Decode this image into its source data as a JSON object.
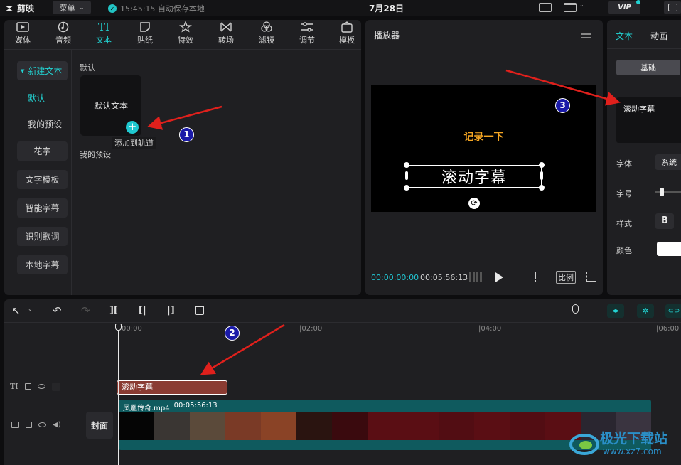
{
  "app": {
    "logo": "剪映",
    "menu_label": "菜单",
    "autosave": "15:45:15 自动保存本地",
    "project_title": "7月28日",
    "vip": "VIP"
  },
  "toolbar": {
    "tabs": [
      {
        "label": "媒体",
        "icon": "media-icon"
      },
      {
        "label": "音频",
        "icon": "audio-icon"
      },
      {
        "label": "文本",
        "icon": "text-icon",
        "active": true
      },
      {
        "label": "贴纸",
        "icon": "sticker-icon"
      },
      {
        "label": "特效",
        "icon": "effects-icon"
      },
      {
        "label": "转场",
        "icon": "transition-icon"
      },
      {
        "label": "滤镜",
        "icon": "filter-icon"
      },
      {
        "label": "调节",
        "icon": "adjust-icon"
      },
      {
        "label": "模板",
        "icon": "template-icon"
      }
    ]
  },
  "sidebar": {
    "items": [
      "新建文本",
      "默认",
      "我的预设",
      "花字",
      "文字模板",
      "智能字幕",
      "识别歌词",
      "本地字幕"
    ]
  },
  "content": {
    "section_default": "默认",
    "card_label": "默认文本",
    "add_tooltip": "添加到轨道",
    "section_presets": "我的预设"
  },
  "player": {
    "title": "播放器",
    "video_text_top": "记录一下",
    "video_text_main": "滚动字幕",
    "current_time": "00:00:00:00",
    "duration": "00:05:56:13",
    "ratio_label": "比例"
  },
  "inspector": {
    "tab_text": "文本",
    "tab_anim": "动画",
    "sub_tab": "基础",
    "text_value": "滚动字幕",
    "font_label": "字体",
    "font_value": "系统",
    "size_label": "字号",
    "style_label": "样式",
    "style_bold": "B",
    "color_label": "颜色"
  },
  "timeline": {
    "ruler": [
      "00:00",
      "|02:00",
      "|04:00",
      "|06:00"
    ],
    "text_clip": "滚动字幕",
    "video_clip_name": "凤凰传奇.mp4",
    "video_clip_duration": "00:05:56:13",
    "cover_label": "封面"
  },
  "annotations": {
    "n1": "1",
    "n2": "2",
    "n3": "3"
  },
  "watermark": {
    "line1": "极光下载站",
    "line2": "www.xz7.com"
  },
  "colors": {
    "accent": "#22d3d3",
    "text_clip": "#8a3b32",
    "video_track": "#0f5a5e",
    "arrow": "#e0201c"
  }
}
